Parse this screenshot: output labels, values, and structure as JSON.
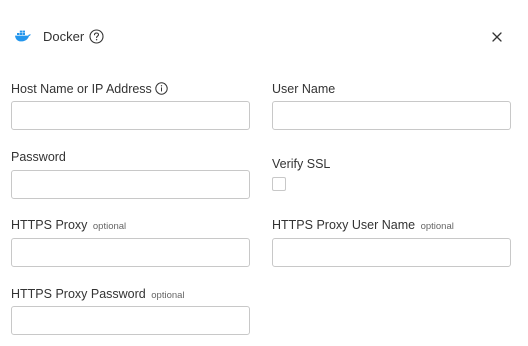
{
  "dialog": {
    "title": "Docker",
    "close_symbol": "×",
    "icons": {
      "logo": "docker-icon",
      "help": "help-circle-icon",
      "close": "close-icon",
      "info": "info-icon"
    },
    "colors": {
      "docker_blue": "#2496ed",
      "border": "#c8c8c8",
      "text": "#333333"
    }
  },
  "form": {
    "host": {
      "label": "Host Name or IP Address",
      "value": ""
    },
    "user_name": {
      "label": "User Name",
      "value": ""
    },
    "password": {
      "label": "Password",
      "value": ""
    },
    "verify_ssl": {
      "label": "Verify SSL",
      "checked": false
    },
    "https_proxy": {
      "label": "HTTPS Proxy",
      "optional": "optional",
      "value": ""
    },
    "https_proxy_user": {
      "label": "HTTPS Proxy User Name",
      "optional": "optional",
      "value": ""
    },
    "https_proxy_password": {
      "label": "HTTPS Proxy Password",
      "optional": "optional",
      "value": ""
    }
  }
}
